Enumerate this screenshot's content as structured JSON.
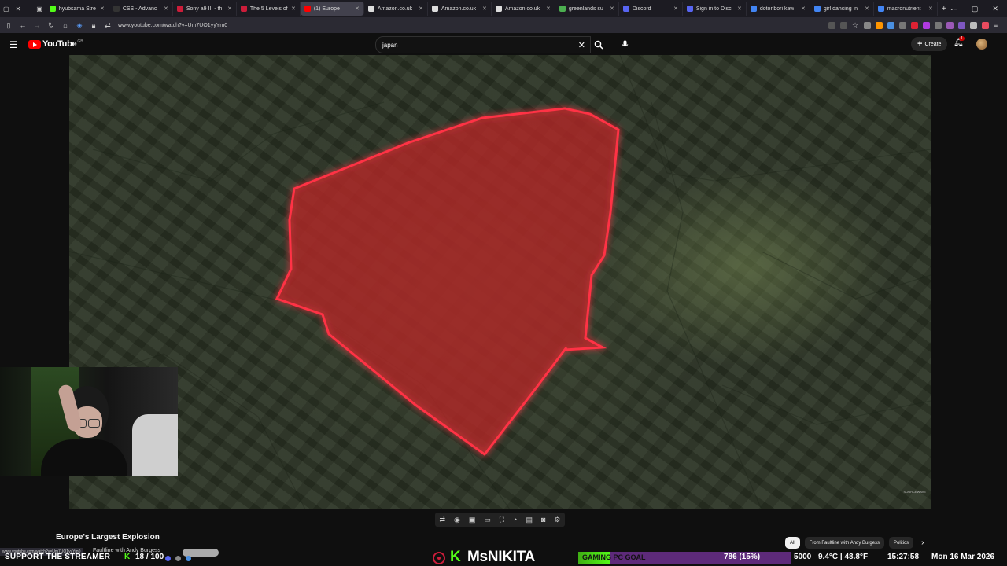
{
  "browser": {
    "tabs": [
      {
        "label": "hyubsama Stre",
        "color": "#53fc18"
      },
      {
        "label": "CSS - Advanc",
        "color": "#333333"
      },
      {
        "label": "Sony a9 III - th",
        "color": "#cc1d3a"
      },
      {
        "label": "The 5 Levels of",
        "color": "#cc1d3a"
      },
      {
        "label": "(1) Europe",
        "color": "#ff0000",
        "active": true
      },
      {
        "label": "Amazon.co.uk",
        "color": "#dddddd"
      },
      {
        "label": "Amazon.co.uk",
        "color": "#dddddd"
      },
      {
        "label": "Amazon.co.uk",
        "color": "#dddddd"
      },
      {
        "label": "greenlands su",
        "color": "#4caf50"
      },
      {
        "label": "Discord",
        "color": "#5865f2"
      },
      {
        "label": "Sign in to Disc",
        "color": "#5865f2"
      },
      {
        "label": "dotonbori kaw",
        "color": "#4285f4"
      },
      {
        "label": "girl dancing in",
        "color": "#4285f4"
      },
      {
        "label": "macronutrient",
        "color": "#4285f4"
      }
    ],
    "new_tab_label": "+",
    "url": "www.youtube.com/watch?v=Um7UO1yyYm0"
  },
  "youtube": {
    "logo_text": "YouTube",
    "logo_country": "GB",
    "search_value": "japan",
    "create_label": "Create",
    "notification_count": "1",
    "video_watermark": "SOURCEWAVE"
  },
  "video": {
    "title": "Europe's Largest Explosion",
    "channel": "Faultline with Andy Burgess",
    "status_url": "www.youtube.com/watch?v=Um7UO1yyYm0"
  },
  "chips": [
    {
      "label": "All",
      "active": true
    },
    {
      "label": "From Faultline with Andy Burgess"
    },
    {
      "label": "Politics"
    }
  ],
  "stream_overlay": {
    "support_text": "SUPPORT THE STREAMER",
    "kick_icon": "K",
    "sub_count": "18 / 100",
    "streamer_name": "MsNIKITA",
    "goal_label": "GAMING PC GOAL",
    "goal_value": "786 (15%)",
    "goal_fraction": 0.15,
    "goal_target": "5000",
    "weather": "9.4°C | 48.8°F",
    "time": "15:27:58",
    "date": "Mon 16 Mar 2026",
    "accent_green": "#53fc18"
  }
}
